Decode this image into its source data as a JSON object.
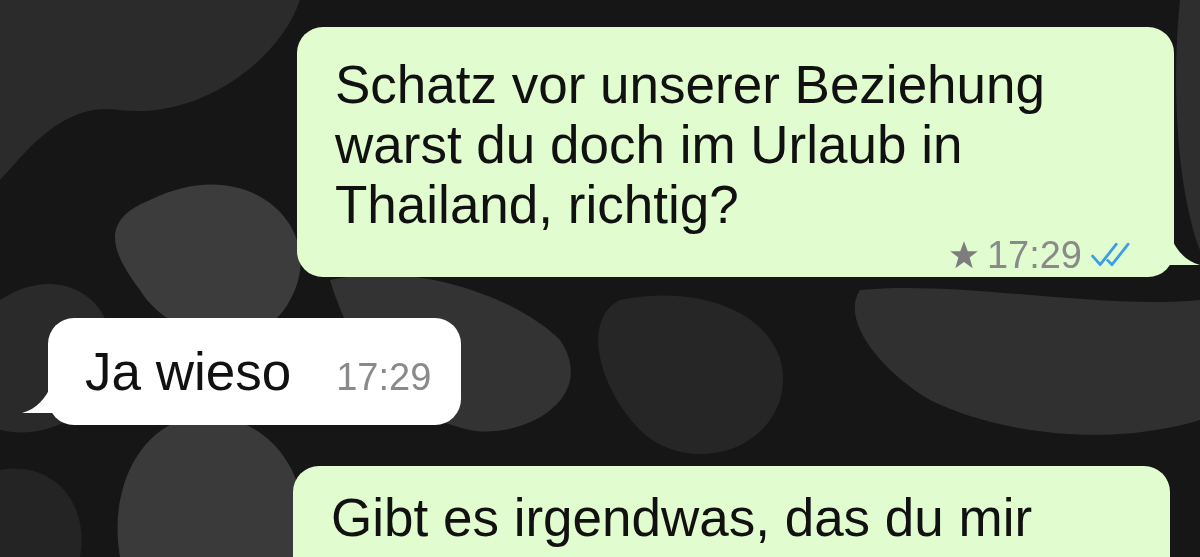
{
  "messages": [
    {
      "kind": "outgoing",
      "text": "Schatz vor unserer Beziehung warst du doch im Urlaub in Thailand, richtig?",
      "time": "17:29",
      "starred": true,
      "read": true
    },
    {
      "kind": "incoming",
      "text": "Ja wieso",
      "time": "17:29",
      "starred": false
    },
    {
      "kind": "outgoing",
      "text": "Gibt es irgendwas, das du mir"
    }
  ]
}
